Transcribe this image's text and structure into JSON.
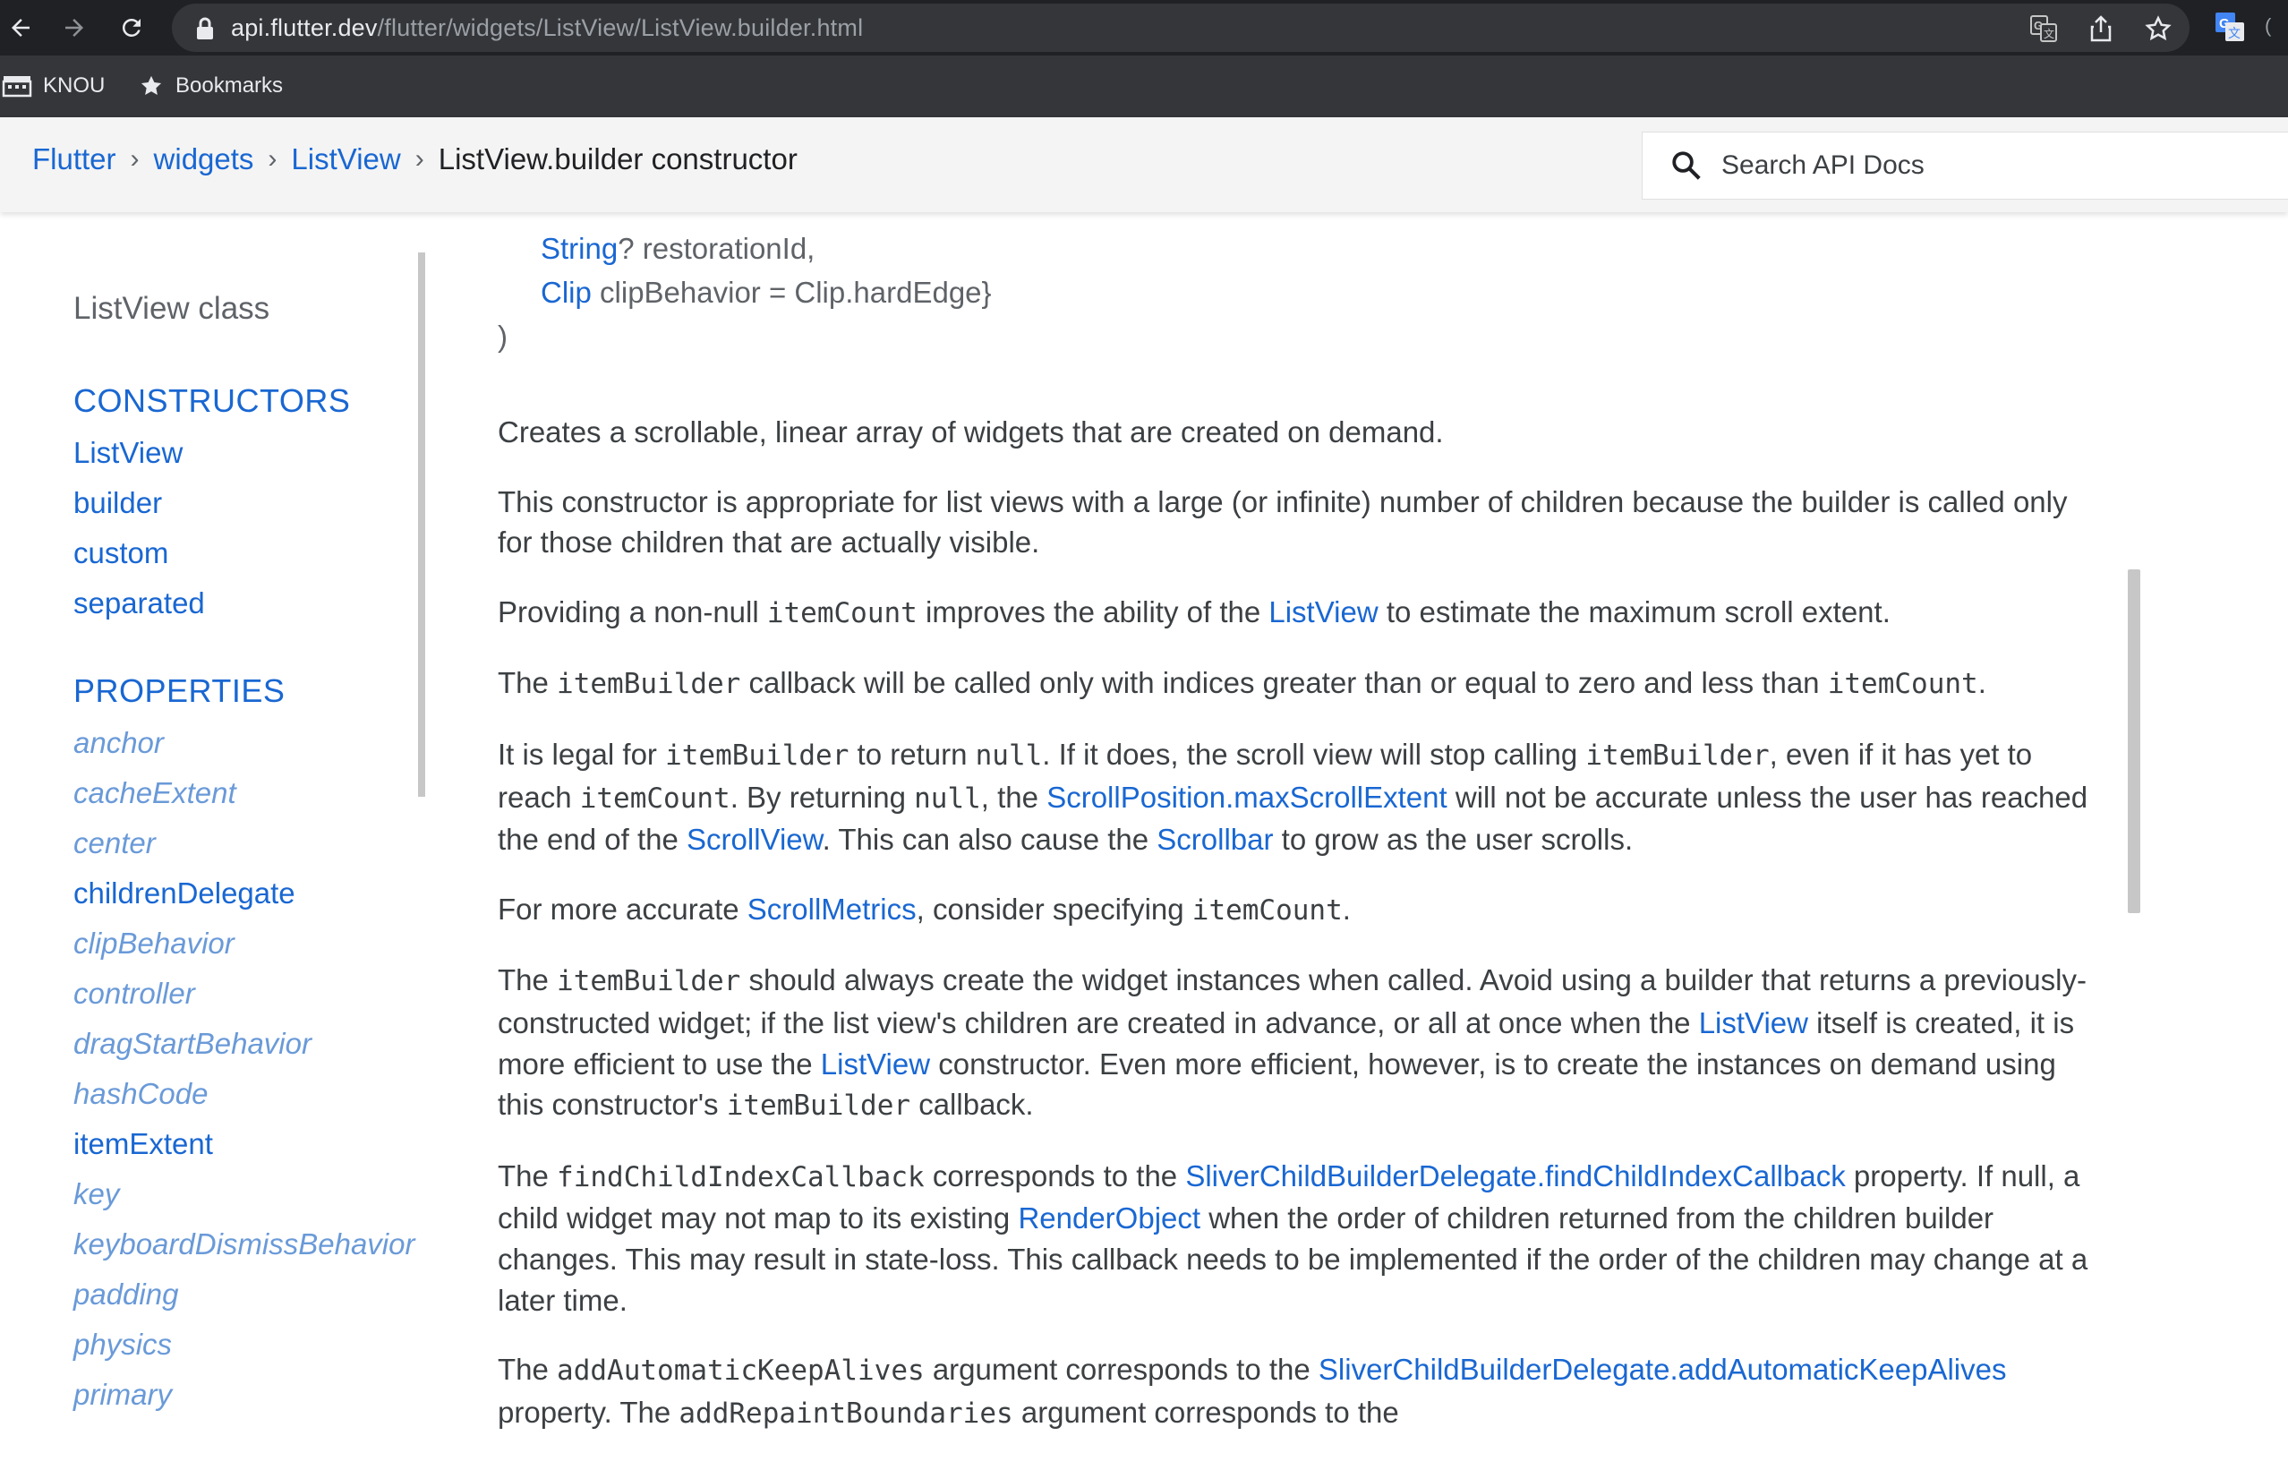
{
  "browser": {
    "url_host": "api.flutter.dev",
    "url_path": "/flutter/widgets/ListView/ListView.builder.html",
    "bookmarks": [
      {
        "label": "KNOU",
        "icon": "building-icon"
      },
      {
        "label": "Bookmarks",
        "icon": "star-icon"
      }
    ],
    "icons": [
      "back-arrow-icon",
      "forward-arrow-icon",
      "reload-icon",
      "lock-icon",
      "translate-icon",
      "share-icon",
      "bookmark-star-icon",
      "google-translate-extension-icon"
    ]
  },
  "header": {
    "breadcrumbs": [
      "Flutter",
      "widgets",
      "ListView"
    ],
    "current": "ListView.builder constructor",
    "search_placeholder": "Search API Docs"
  },
  "sidebar": {
    "title": "ListView class",
    "constructors_heading": "CONSTRUCTORS",
    "constructors": [
      "ListView",
      "builder",
      "custom",
      "separated"
    ],
    "properties_heading": "PROPERTIES",
    "properties": [
      {
        "label": "anchor",
        "inherited": true
      },
      {
        "label": "cacheExtent",
        "inherited": true
      },
      {
        "label": "center",
        "inherited": true
      },
      {
        "label": "childrenDelegate",
        "inherited": false
      },
      {
        "label": "clipBehavior",
        "inherited": true
      },
      {
        "label": "controller",
        "inherited": true
      },
      {
        "label": "dragStartBehavior",
        "inherited": true
      },
      {
        "label": "hashCode",
        "inherited": true
      },
      {
        "label": "itemExtent",
        "inherited": false
      },
      {
        "label": "key",
        "inherited": true
      },
      {
        "label": "keyboardDismissBehavior",
        "inherited": true
      },
      {
        "label": "padding",
        "inherited": true
      },
      {
        "label": "physics",
        "inherited": true
      },
      {
        "label": "primary",
        "inherited": true
      }
    ]
  },
  "code": {
    "line1_type": "String",
    "line1_rest": "? restorationId,",
    "line2_type": "Clip",
    "line2_rest": " clipBehavior = Clip.hardEdge}",
    "line3": ")"
  },
  "content": {
    "p1": "Creates a scrollable, linear array of widgets that are created on demand.",
    "p2": "This constructor is appropriate for list views with a large (or infinite) number of children because the builder is called only for those children that are actually visible.",
    "p3": {
      "t1": "Providing a non-null ",
      "c1": "itemCount",
      "t2": " improves the ability of the ",
      "l1": "ListView",
      "t3": " to estimate the maximum scroll extent."
    },
    "p4": {
      "t1": "The ",
      "c1": "itemBuilder",
      "t2": " callback will be called only with indices greater than or equal to zero and less than ",
      "c2": "itemCount",
      "t3": "."
    },
    "p5": {
      "t1": "It is legal for ",
      "c1": "itemBuilder",
      "t2": " to return ",
      "c2": "null",
      "t3": ". If it does, the scroll view will stop calling ",
      "c3": "itemBuilder",
      "t4": ", even if it has yet to reach ",
      "c4": "itemCount",
      "t5": ". By returning ",
      "c5": "null",
      "t6": ", the ",
      "l1": "ScrollPosition.maxScrollExtent",
      "t7": " will not be accurate unless the user has reached the end of the ",
      "l2": "ScrollView",
      "t8": ". This can also cause the ",
      "l3": "Scrollbar",
      "t9": " to grow as the user scrolls."
    },
    "p6": {
      "t1": "For more accurate ",
      "l1": "ScrollMetrics",
      "t2": ", consider specifying ",
      "c1": "itemCount",
      "t3": "."
    },
    "p7": {
      "t1": "The ",
      "c1": "itemBuilder",
      "t2": " should always create the widget instances when called. Avoid using a builder that returns a previously-constructed widget; if the list view's children are created in advance, or all at once when the ",
      "l1": "ListView",
      "t3": " itself is created, it is more efficient to use the ",
      "l2": "ListView",
      "t4": " constructor. Even more efficient, however, is to create the instances on demand using this constructor's ",
      "c2": "itemBuilder",
      "t5": " callback."
    },
    "p8": {
      "t1": "The ",
      "c1": "findChildIndexCallback",
      "t2": " corresponds to the ",
      "l1": "SliverChildBuilderDelegate.findChildIndexCallback",
      "t3": " property. If null, a child widget may not map to its existing ",
      "l2": "RenderObject",
      "t4": " when the order of children returned from the children builder changes. This may result in state-loss. This callback needs to be implemented if the order of the children may change at a later time."
    },
    "p9": {
      "t1": "The ",
      "c1": "addAutomaticKeepAlives",
      "t2": " argument corresponds to the ",
      "l1": "SliverChildBuilderDelegate.addAutomaticKeepAlives",
      "t3": " property. The ",
      "c2": "addRepaintBoundaries",
      "t4": " argument corresponds to the"
    }
  },
  "colors": {
    "link": "#1967d2",
    "inherited_link": "#6a9ad8",
    "text": "#3c4043",
    "chrome_dark": "#202124",
    "header_bg": "#f4f4f4"
  }
}
